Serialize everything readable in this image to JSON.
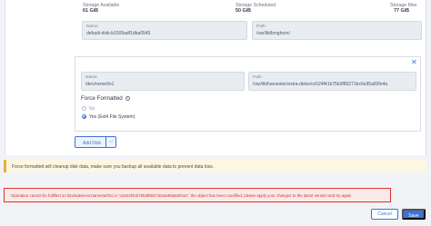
{
  "storage_summary": {
    "available_label": "Storage Available",
    "available_value": "61 GiB",
    "scheduled_label": "Storage Scheduled",
    "scheduled_value": "50 GiB",
    "max_label": "Storage Max",
    "max_value": "77 GiB"
  },
  "disk1": {
    "name_label": "Name",
    "name_value": "default-disk-b1509adf1dba0545",
    "path_label": "Path",
    "path_value": "/var/lib/longhorn/"
  },
  "disk2": {
    "close_glyph": "✕",
    "name_label": "Name",
    "name_value": "/dev/nvme0n1",
    "path_label": "Path",
    "path_value": "/var/lib/harvester/extra-disks/ce524f41b75b3f89271bc6e95a82fe4a",
    "force_formatted_label": "Force Formatted",
    "info_glyph": "i",
    "options": [
      {
        "label": "No",
        "selected": false
      },
      {
        "label": "Yes (Ext4 File System)",
        "selected": true
      }
    ]
  },
  "add_disk": {
    "label": "Add Disk",
    "chevron": "⌵"
  },
  "warning_banner": "Force formatted will cleanup disk data, make sure you backup all available data to prevent data loss.",
  "error_banner": "Operation cannot be fulfilled on blockdevices.harvesterhci.io \"ce524f41b75b3f89271bc6e95a82fe4a\": the object has been modified; please apply your changes to the latest version and try again",
  "footer": {
    "cancel_label": "Cancel",
    "save_label": "Save"
  },
  "colors": {
    "accent": "#3d73d5",
    "warning": "#e2b23a",
    "error": "#d9342b"
  }
}
